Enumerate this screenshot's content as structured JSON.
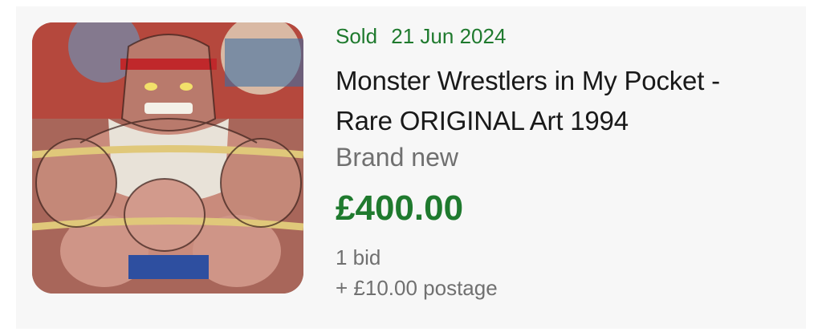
{
  "listing": {
    "sold_label": "Sold",
    "sold_date": "21 Jun 2024",
    "title_line1": "Monster Wrestlers in My Pocket -",
    "title_line2": "Rare ORIGINAL Art 1994",
    "condition": "Brand new",
    "price": "£400.00",
    "bids": "1 bid",
    "postage": "+ £10.00 postage",
    "thumbnail_description": "illustration of muscular monster wrestler with headband and ropes",
    "colors": {
      "sold_green": "#1f7a2e",
      "title": "#191919",
      "secondary_text": "#707070",
      "card_background": "#f7f7f7"
    }
  }
}
